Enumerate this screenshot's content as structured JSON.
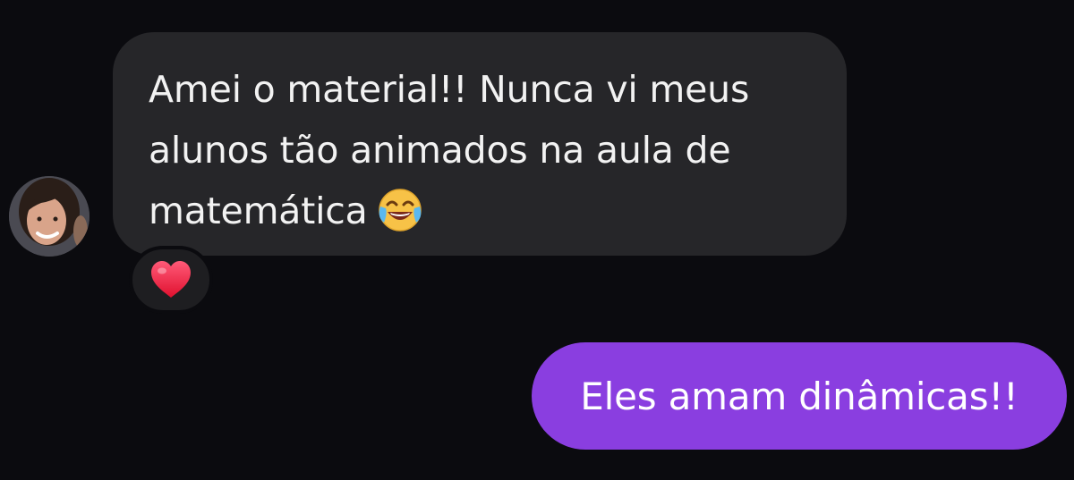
{
  "conversation": {
    "incoming": {
      "lines": [
        "Amei o material!! Nunca vi meus",
        "alunos tão animados na aula de",
        "matemática"
      ],
      "emoji": "face-with-tears-of-joy",
      "reaction": "heart"
    },
    "outgoing": {
      "text": "Eles amam dinâmicas!!"
    }
  },
  "colors": {
    "background": "#0b0b0f",
    "incoming_bubble": "#262629",
    "outgoing_bubble": "#8a3ee0",
    "text": "#f2f2f2"
  }
}
